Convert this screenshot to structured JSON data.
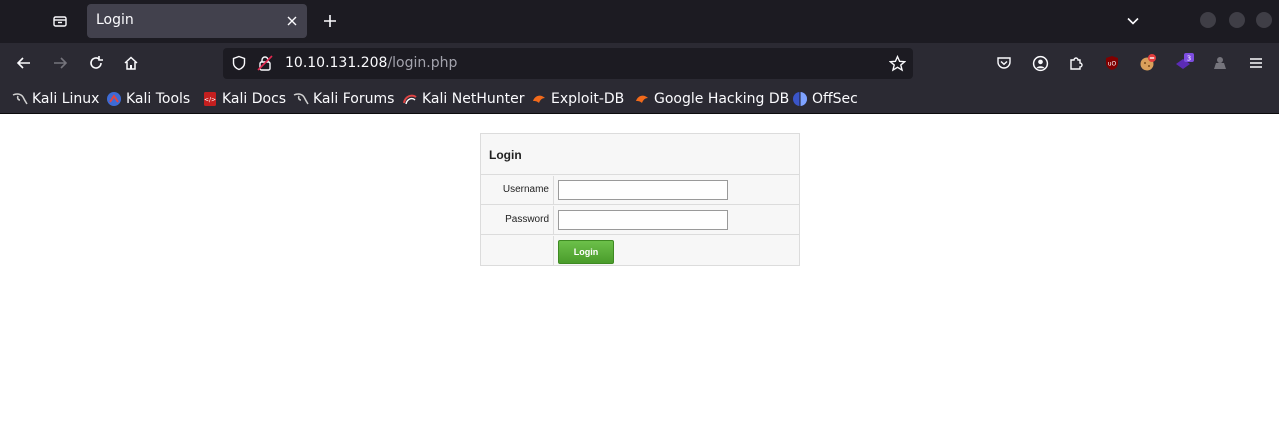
{
  "browser": {
    "tab": {
      "title": "Login"
    },
    "url": {
      "host": "10.10.131.208",
      "path": "/login.php"
    },
    "bookmarks": [
      {
        "label": "Kali Linux",
        "icon": "kali-dragon-icon"
      },
      {
        "label": "Kali Tools",
        "icon": "kali-tools-icon"
      },
      {
        "label": "Kali Docs",
        "icon": "kali-docs-icon"
      },
      {
        "label": "Kali Forums",
        "icon": "kali-dragon-icon"
      },
      {
        "label": "Kali NetHunter",
        "icon": "nethunter-icon"
      },
      {
        "label": "Exploit-DB",
        "icon": "exploitdb-icon"
      },
      {
        "label": "Google Hacking DB",
        "icon": "exploitdb-icon"
      },
      {
        "label": "OffSec",
        "icon": "offsec-icon"
      }
    ],
    "extension_badge": "3",
    "colors": {
      "tabstrip": "#1c1b22",
      "toolbar": "#2b2a33",
      "urlbar": "#1c1b22"
    }
  },
  "page": {
    "login": {
      "title": "Login",
      "username_label": "Username",
      "password_label": "Password",
      "username_value": "",
      "password_value": "",
      "submit_label": "Login",
      "button_color": "#5aad39"
    }
  }
}
